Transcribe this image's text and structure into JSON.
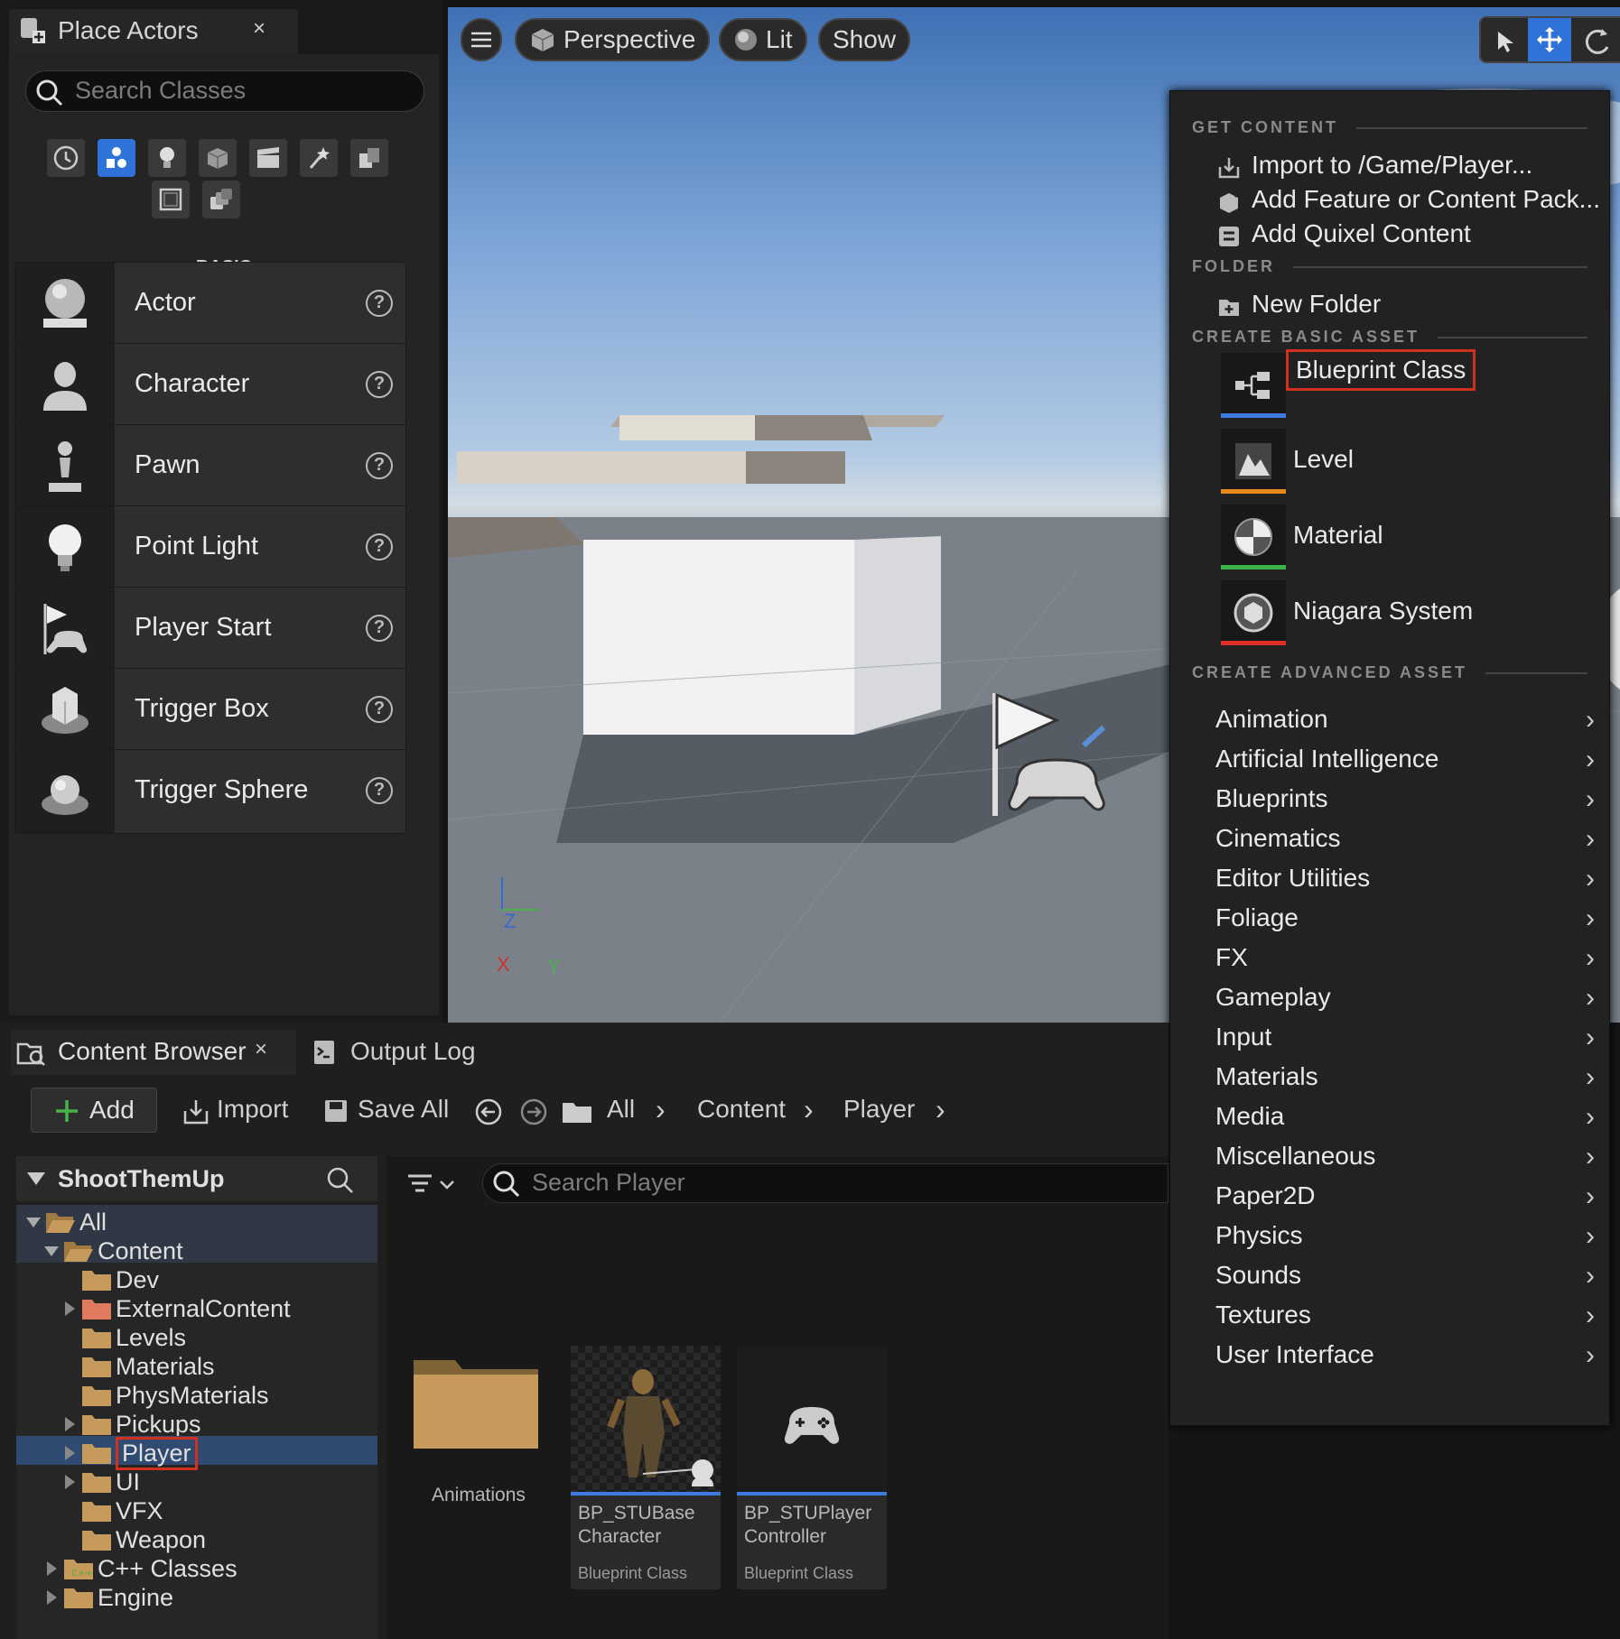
{
  "place_actors": {
    "title": "Place Actors",
    "close": "×",
    "search_placeholder": "Search Classes",
    "category": "BASIC",
    "items": [
      {
        "label": "Actor",
        "help": "?"
      },
      {
        "label": "Character",
        "help": "?"
      },
      {
        "label": "Pawn",
        "help": "?"
      },
      {
        "label": "Point Light",
        "help": "?"
      },
      {
        "label": "Player Start",
        "help": "?"
      },
      {
        "label": "Trigger Box",
        "help": "?"
      },
      {
        "label": "Trigger Sphere",
        "help": "?"
      }
    ]
  },
  "viewport": {
    "perspective": "Perspective",
    "lit": "Lit",
    "show": "Show",
    "axis": {
      "z": "Z",
      "x": "X",
      "y": "Y"
    }
  },
  "menu": {
    "sections": {
      "get_content": "GET CONTENT",
      "folder": "FOLDER",
      "basic": "CREATE BASIC ASSET",
      "advanced": "CREATE ADVANCED ASSET"
    },
    "get_content": [
      "Import to /Game/Player...",
      "Add Feature or Content Pack...",
      "Add Quixel Content"
    ],
    "folder": [
      "New Folder"
    ],
    "basic_assets": [
      {
        "label": "Blueprint Class",
        "color": "#3d7be0"
      },
      {
        "label": "Level",
        "color": "#e88a1a"
      },
      {
        "label": "Material",
        "color": "#3bb54a"
      },
      {
        "label": "Niagara System",
        "color": "#e0302a"
      }
    ],
    "advanced": [
      "Animation",
      "Artificial Intelligence",
      "Blueprints",
      "Cinematics",
      "Editor Utilities",
      "Foliage",
      "FX",
      "Gameplay",
      "Input",
      "Materials",
      "Media",
      "Miscellaneous",
      "Paper2D",
      "Physics",
      "Sounds",
      "Textures",
      "User Interface"
    ],
    "chevron": "›"
  },
  "content_browser": {
    "title": "Content Browser",
    "close": "×",
    "output_log": "Output Log",
    "add": "Add",
    "import": "Import",
    "save_all": "Save All",
    "breadcrumb": [
      "All",
      "Content",
      "Player"
    ],
    "sep": "›",
    "project": "ShootThemUp",
    "search_placeholder": "Search Player",
    "tree": [
      "All",
      "Content",
      "Dev",
      "ExternalContent",
      "Levels",
      "Materials",
      "PhysMaterials",
      "Pickups",
      "Player",
      "UI",
      "VFX",
      "Weapon",
      "C++ Classes",
      "Engine"
    ],
    "tiles": [
      {
        "name1": "Animations"
      },
      {
        "name1": "BP_STUBase",
        "name2": "Character",
        "type": "Blueprint Class"
      },
      {
        "name1": "BP_STUPlayer",
        "name2": "Controller",
        "type": "Blueprint Class"
      }
    ]
  }
}
